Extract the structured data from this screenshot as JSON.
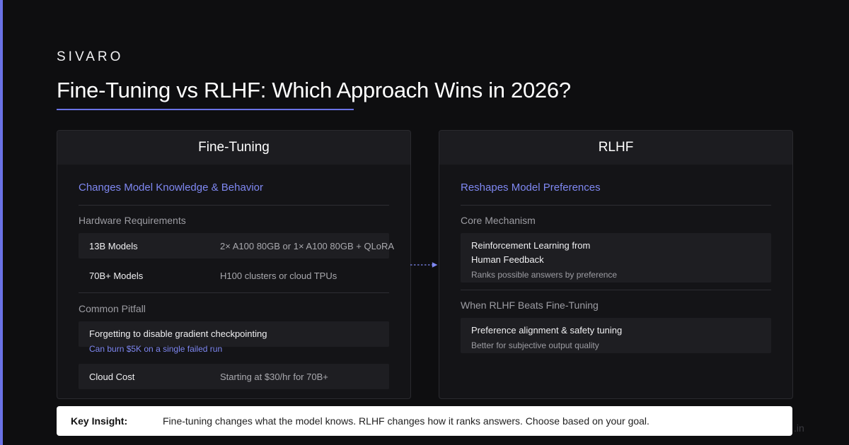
{
  "brand": "SIVARO",
  "title": "Fine-Tuning vs RLHF: Which Approach Wins in 2026?",
  "colors": {
    "accent": "#6a72e6",
    "accent_text": "#7f88f2",
    "background": "#0e0e10"
  },
  "left_card": {
    "header": "Fine-Tuning",
    "subtitle": "Changes Model Knowledge & Behavior",
    "hardware_label": "Hardware Requirements",
    "hardware_rows": [
      {
        "key": "13B Models",
        "value": "2× A100 80GB or 1× A100 80GB + QLoRA"
      },
      {
        "key": "70B+ Models",
        "value": "H100 clusters or cloud TPUs"
      }
    ],
    "pitfall_label": "Common Pitfall",
    "pitfall_main": "Forgetting to disable gradient checkpointing",
    "pitfall_note": "Can burn $5K on a single failed run",
    "cost_key": "Cloud Cost",
    "cost_value": "Starting at $30/hr for 70B+"
  },
  "right_card": {
    "header": "RLHF",
    "subtitle": "Reshapes Model Preferences",
    "mechanism_label": "Core Mechanism",
    "mechanism_line1": "Reinforcement Learning from",
    "mechanism_line2": "Human Feedback",
    "mechanism_note": "Ranks possible answers by preference",
    "beats_label": "When RLHF Beats Fine-Tuning",
    "beats_main": "Preference alignment & safety tuning",
    "beats_note": "Better for subjective output quality"
  },
  "insight": {
    "label": "Key Insight:",
    "text": "Fine-tuning changes what the model knows. RLHF changes how it ranks answers. Choose based on your goal."
  },
  "watermark": ".in"
}
